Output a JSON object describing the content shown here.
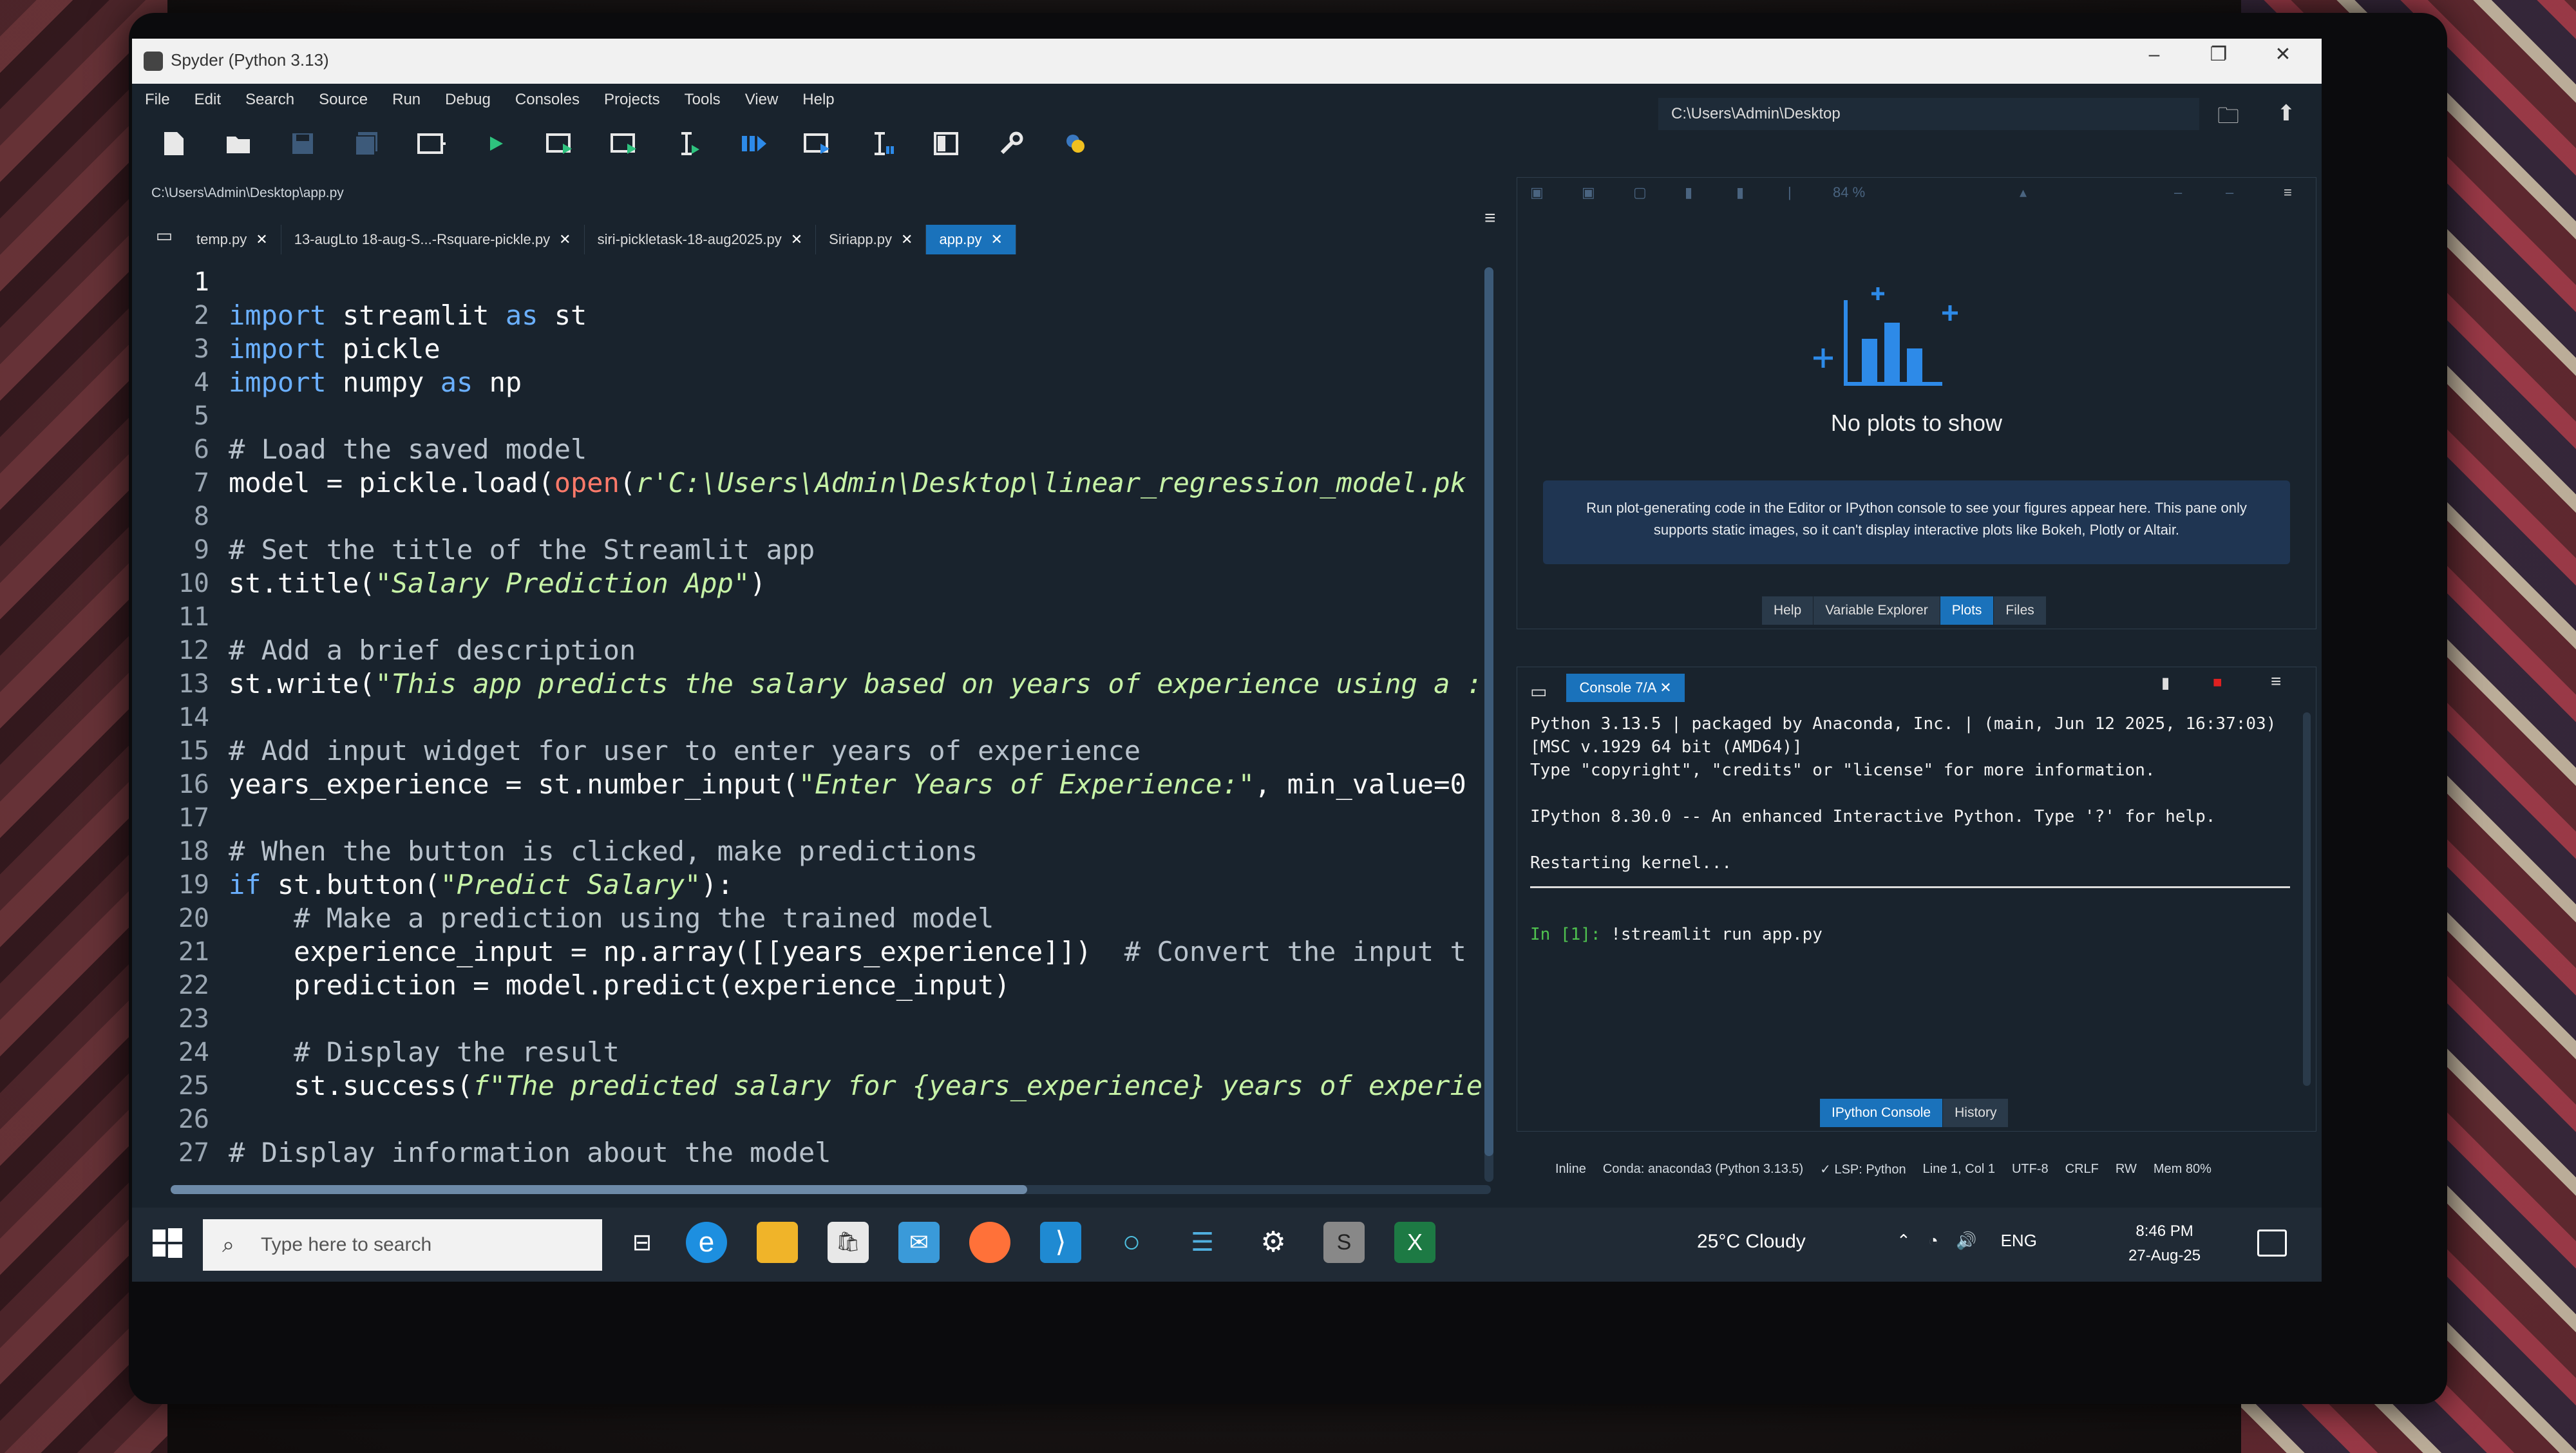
{
  "window": {
    "title": "Spyder (Python 3.13)",
    "controls": [
      "–",
      "❐",
      "✕"
    ]
  },
  "menu": [
    "File",
    "Edit",
    "Search",
    "Source",
    "Run",
    "Debug",
    "Consoles",
    "Projects",
    "Tools",
    "View",
    "Help"
  ],
  "toolbar": {
    "working_dir": "C:\\Users\\Admin\\Desktop"
  },
  "editor": {
    "path": "C:\\Users\\Admin\\Desktop\\app.py",
    "tabs": [
      {
        "label": "temp.py"
      },
      {
        "label": "13-augLto 18-aug-S...-Rsquare-pickle.py"
      },
      {
        "label": "siri-pickletask-18-aug2025.py"
      },
      {
        "label": "Siriapp.py"
      },
      {
        "label": "app.py",
        "active": true
      }
    ],
    "line_numbers": [
      "1",
      "2",
      "3",
      "4",
      "5",
      "6",
      "7",
      "8",
      "9",
      "10",
      "11",
      "12",
      "13",
      "14",
      "15",
      "16",
      "17",
      "18",
      "19",
      "20",
      "21",
      "22",
      "23",
      "24",
      "25",
      "26",
      "27"
    ],
    "code": {
      "l2a": "import",
      "l2b": " streamlit ",
      "l2c": "as",
      "l2d": " st",
      "l3a": "import",
      "l3b": " pickle",
      "l4a": "import",
      "l4b": " numpy ",
      "l4c": "as",
      "l4d": " np",
      "l6": "# Load the saved model",
      "l7a": "model = pickle.load(",
      "l7b": "open",
      "l7c": "(",
      "l7d": "r'C:\\Users\\Admin\\Desktop\\linear_regression_model.pk",
      "l9": "# Set the title of the Streamlit app",
      "l10a": "st.title(",
      "l10b": "\"Salary Prediction App\"",
      "l10c": ")",
      "l12": "# Add a brief description",
      "l13a": "st.write(",
      "l13b": "\"This app predicts the salary based on years of experience using a :",
      "l15": "# Add input widget for user to enter years of experience",
      "l16a": "years_experience = st.number_input(",
      "l16b": "\"Enter Years of Experience:\"",
      "l16c": ", min_value=0",
      "l18": "# When the button is clicked, make predictions",
      "l19a": "if",
      "l19b": " st.button(",
      "l19c": "\"Predict Salary\"",
      "l19d": "):",
      "l20": "    # Make a prediction using the trained model",
      "l21a": "    experience_input = np.array([[years_experience]])  ",
      "l21b": "# Convert the input t",
      "l22": "    prediction = model.predict(experience_input)",
      "l24": "    # Display the result",
      "l25a": "    st.success(",
      "l25b": "f\"The predicted salary for {years_experience} years of experie",
      "l27": "# Display information about the model"
    }
  },
  "plots": {
    "empty_title": "No plots to show",
    "info_line1": "Run plot-generating code in the Editor or IPython console to see your figures appear here. This pane only",
    "info_line2": "supports static images, so it can't display interactive plots like Bokeh, Plotly or Altair.",
    "tabs": [
      "Help",
      "Variable Explorer",
      "Plots",
      "Files"
    ],
    "active_tab": "Plots",
    "zoom": "84 %"
  },
  "console": {
    "tab": "Console 7/A",
    "banner1": "Python 3.13.5 | packaged by Anaconda, Inc. | (main, Jun 12 2025, 16:37:03)",
    "banner2": "[MSC v.1929 64 bit (AMD64)]",
    "banner3": "Type \"copyright\", \"credits\" or \"license\" for more information.",
    "banner4": "IPython 8.30.0 -- An enhanced Interactive Python. Type '?' for help.",
    "restart": "Restarting kernel...",
    "prompt_in": "In [1]:",
    "command": " !streamlit run app.py",
    "bottom_tabs": [
      "IPython Console",
      "History"
    ]
  },
  "status": {
    "inline": "Inline",
    "conda": "Conda: anaconda3 (Python 3.13.5)",
    "lsp": "✓ LSP: Python",
    "position": "Line 1, Col 1",
    "encoding": "UTF-8",
    "eol": "CRLF",
    "rw": "RW",
    "mem": "Mem 80%"
  },
  "taskbar": {
    "search_placeholder": "Type here to search",
    "weather": "25°C  Cloudy",
    "lang": "ENG",
    "time": "8:46 PM",
    "date": "27-Aug-25"
  },
  "colors": {
    "bg": "#19232d",
    "accent": "#1a72bb",
    "keyword": "#6bb0ff",
    "string": "#c6f2a6"
  }
}
